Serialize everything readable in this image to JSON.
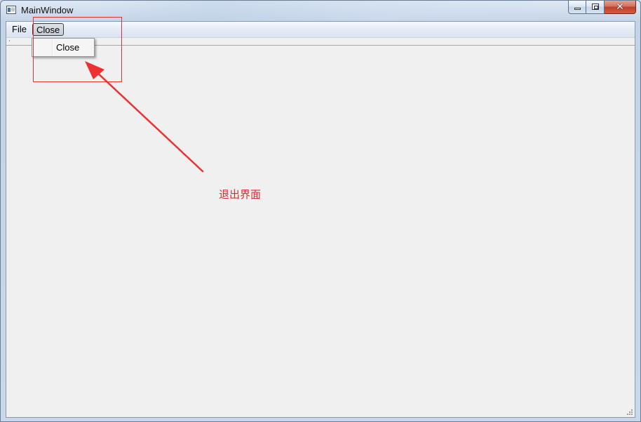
{
  "window": {
    "title": "MainWindow",
    "close_glyph": "✕"
  },
  "menubar": {
    "items": [
      {
        "label": "File"
      },
      {
        "label": "Close"
      }
    ]
  },
  "dropdown": {
    "items": [
      {
        "label": "Close"
      }
    ]
  },
  "annotation": {
    "text": "退出界面",
    "color": "#e53333"
  },
  "icons": {
    "app": "window-app-icon",
    "minimize": "minimize-icon",
    "maximize": "maximize-icon",
    "close": "close-icon"
  }
}
